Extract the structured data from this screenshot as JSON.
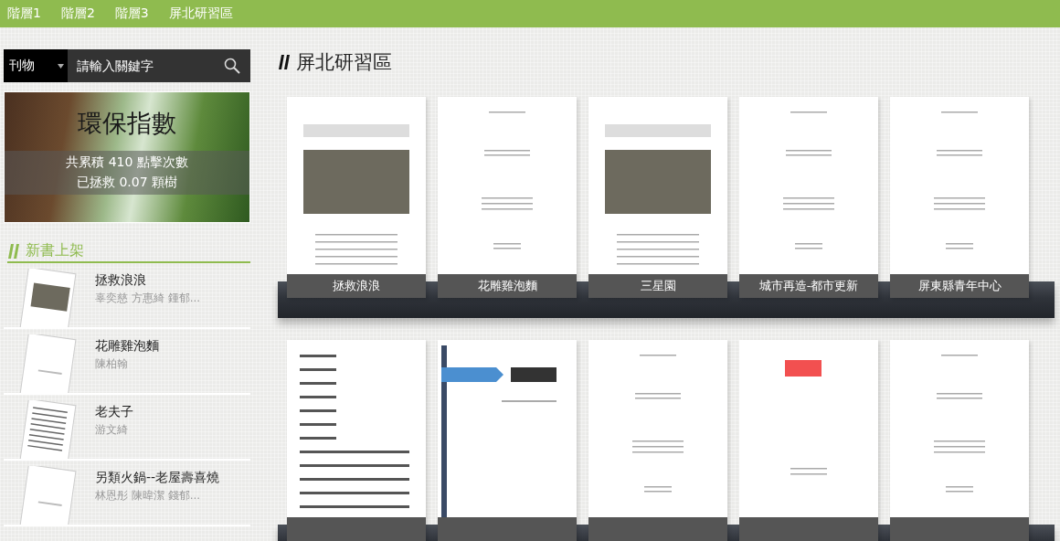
{
  "nav": {
    "items": [
      {
        "label": "階層1"
      },
      {
        "label": "階層2"
      },
      {
        "label": "階層3"
      },
      {
        "label": "屏北研習區"
      }
    ]
  },
  "search": {
    "category": "刊物",
    "placeholder": "請輸入關鍵字"
  },
  "eco_banner": {
    "title": "環保指數",
    "clicks": "共累積 410 點擊次數",
    "trees": "已拯救 0.07 顆樹"
  },
  "new_books": {
    "heading": "新書上架",
    "items": [
      {
        "title": "拯救浪浪",
        "authors": "辜奕慈 方惠綺 鍾郁...",
        "kind": "photo"
      },
      {
        "title": "花雕雞泡麵",
        "authors": "陳柏翰",
        "kind": "text"
      },
      {
        "title": "老夫子",
        "authors": "游文綺",
        "kind": "list"
      },
      {
        "title": "另類火鍋--老屋壽喜燒",
        "authors": "林恩彤 陳暐潔 錢郁...",
        "kind": "text"
      }
    ]
  },
  "shelf": {
    "heading": "屏北研習區",
    "rows": [
      {
        "books": [
          {
            "title": "拯救浪浪",
            "kind": "photo"
          },
          {
            "title": "花雕雞泡麵",
            "kind": "text"
          },
          {
            "title": "三星園",
            "kind": "photo"
          },
          {
            "title": "城市再造-都市更新",
            "kind": "text"
          },
          {
            "title": "屏東縣青年中心",
            "kind": "text"
          }
        ]
      },
      {
        "books": [
          {
            "kind": "list"
          },
          {
            "kind": "banner"
          },
          {
            "kind": "text"
          },
          {
            "kind": "title"
          },
          {
            "kind": "text"
          }
        ]
      }
    ]
  }
}
